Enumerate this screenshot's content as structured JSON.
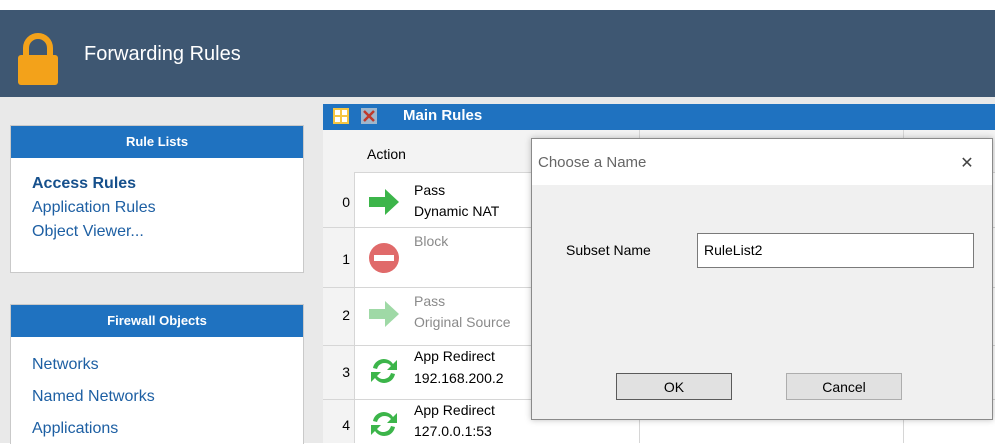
{
  "header": {
    "title": "Forwarding Rules",
    "icon": "lock-icon",
    "bg": "#3e5772",
    "lock_color": "#f3a21a"
  },
  "sidebar": {
    "rule_lists": {
      "title": "Rule Lists",
      "items": [
        {
          "label": "Access Rules",
          "active": true
        },
        {
          "label": "Application Rules",
          "active": false
        },
        {
          "label": "Object Viewer...",
          "active": false
        }
      ]
    },
    "firewall_objects": {
      "title": "Firewall Objects",
      "items": [
        {
          "label": "Networks"
        },
        {
          "label": "Named Networks"
        },
        {
          "label": "Applications"
        }
      ]
    }
  },
  "grid": {
    "title": "Main Rules",
    "column_action": "Action",
    "rows": [
      {
        "num": "0",
        "line1": "Pass",
        "line2": "Dynamic NAT",
        "icon": "green-arrow-icon",
        "dim": false
      },
      {
        "num": "1",
        "line1": "Block",
        "line2": "",
        "icon": "block-icon",
        "dim": true
      },
      {
        "num": "2",
        "line1": "Pass",
        "line2": "Original Source",
        "icon": "green-arrow-icon",
        "dim": true
      },
      {
        "num": "3",
        "line1": "App Redirect",
        "line2": "192.168.200.2",
        "icon": "redirect-icon",
        "dim": false
      },
      {
        "num": "4",
        "line1": "App Redirect",
        "line2": "127.0.0.1:53",
        "icon": "redirect-icon",
        "dim": false
      }
    ]
  },
  "dialog": {
    "title": "Choose a Name",
    "field_label": "Subset Name",
    "field_value": "RuleList2",
    "ok_label": "OK",
    "cancel_label": "Cancel"
  }
}
